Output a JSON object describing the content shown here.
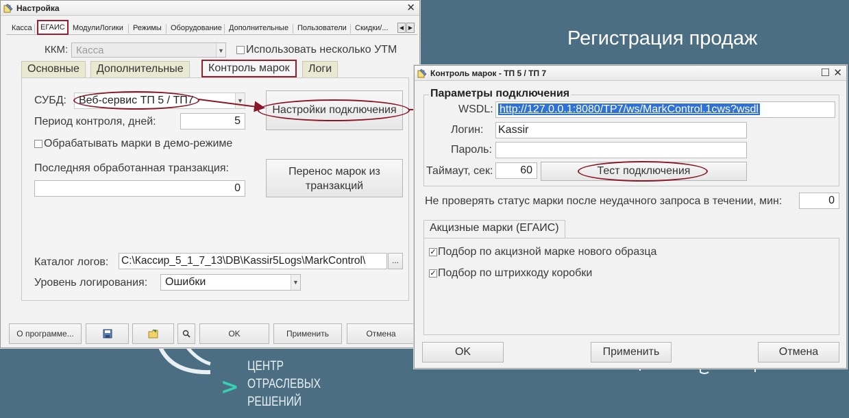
{
  "slide": {
    "title": "Регистрация продаж",
    "logo_lines": [
      "ЦЕНТР",
      "ОТРАСЛЕВЫХ",
      "РЕШЕНИЙ"
    ],
    "logo_chevron": ">"
  },
  "colors": {
    "background": "#4b6e82",
    "highlight": "#9b1c2c",
    "logo_accent": "#36d3b3"
  },
  "settings_window": {
    "title": "Настройка",
    "close_label": "✕",
    "top_tabs": [
      "Касса",
      "ЕГАИС",
      "МодулиЛогики",
      "Режимы",
      "Оборудование",
      "Дополнительные",
      "Пользователи",
      "Скидки/..."
    ],
    "selected_top_tab": "ЕГАИС",
    "kkm_label": "ККМ:",
    "kkm_value": "Касса",
    "multi_utm_label": "Использовать несколько УТМ",
    "inner_tabs": [
      "Основные",
      "Дополнительные",
      "Контроль марок",
      "Логи"
    ],
    "selected_inner_tab": "Контроль марок",
    "subd_label": "СУБД:",
    "subd_value": "Веб-сервис ТП 5 / ТП7",
    "connection_settings_button": "Настройки подключения",
    "period_label": "Период контроля, дней:",
    "period_value": "5",
    "demo_mode_label": "Обрабатывать марки в демо-режиме",
    "last_tx_label": "Последняя обработанная транзакция:",
    "last_tx_value": "0",
    "transfer_button_line1": "Перенос марок из",
    "transfer_button_line2": "транзакций",
    "log_dir_label": "Каталог логов:",
    "log_dir_value": "C:\\Кассир_5_1_7_13\\DB\\Kassir5Logs\\MarkControl\\",
    "browse_label": "...",
    "log_level_label": "Уровень логирования:",
    "log_level_value": "Ошибки",
    "buttons": {
      "about": "О программе...",
      "ok": "OK",
      "apply": "Применить",
      "cancel": "Отмена"
    }
  },
  "mark_control_window": {
    "title": "Контроль марок - ТП 5 / ТП 7",
    "maximize_label": "☐",
    "close_label": "✕",
    "section_title": "Параметры подключения",
    "wsdl_label": "WSDL:",
    "wsdl_value": "http://127.0.0.1:8080/TP7/ws/MarkControl.1cws?wsdl",
    "login_label": "Логин:",
    "login_value": "Kassir",
    "password_label": "Пароль:",
    "password_value": "",
    "timeout_label": "Таймаут, сек:",
    "timeout_value": "60",
    "test_button": "Тест подключения",
    "no_check_label": "Не проверять статус марки после неудачного запроса в течении, мин:",
    "no_check_value": "0",
    "excise_tab": "Акцизные марки (ЕГАИС)",
    "check_new_sample_label": "Подбор по акцизной марке нового образца",
    "check_box_barcode_label": "Подбор по штрихкоду коробки",
    "buttons": {
      "ok": "OK",
      "apply": "Применить",
      "cancel": "Отмена"
    }
  }
}
